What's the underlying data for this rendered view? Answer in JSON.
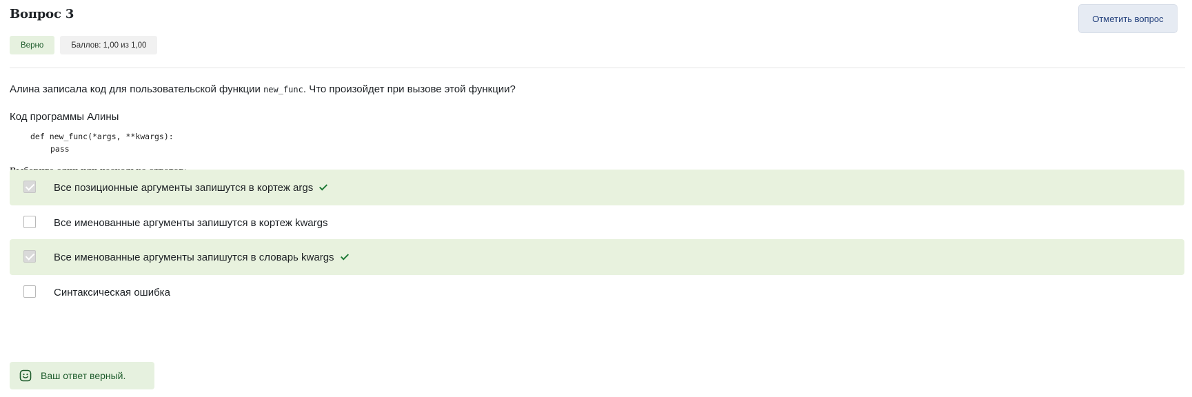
{
  "question": {
    "title": "Вопрос 3",
    "flag_button": "Отметить вопрос",
    "status_badge": "Верно",
    "grade_badge": "Баллов: 1,00 из 1,00",
    "text_before": "Алина записала код для пользовательской функции ",
    "text_code": "new_func",
    "text_after": ". Что произойдет при вызове этой функции?",
    "code_title": "Код программы Алины",
    "code_line1": "def new_func(*args, **kwargs):",
    "code_line2": "pass",
    "prompt": "Выберите один или несколько ответов:"
  },
  "answers": [
    {
      "label": "Все позиционные аргументы запишутся в кортеж args",
      "selected": true,
      "correct": true
    },
    {
      "label": "Все именованные аргументы запишутся в кортеж kwargs",
      "selected": false,
      "correct": false
    },
    {
      "label": "Все именованные аргументы запишутся в словарь kwargs",
      "selected": true,
      "correct": true
    },
    {
      "label": "Синтаксическая ошибка",
      "selected": false,
      "correct": false
    }
  ],
  "feedback": {
    "text": "Ваш ответ верный.",
    "icon": "smile-icon"
  },
  "colors": {
    "correct_bg": "#e8f2de",
    "correct_text": "#1d5b2b",
    "check_green": "#1e7a36",
    "flag_bg": "#e6ebf3"
  }
}
